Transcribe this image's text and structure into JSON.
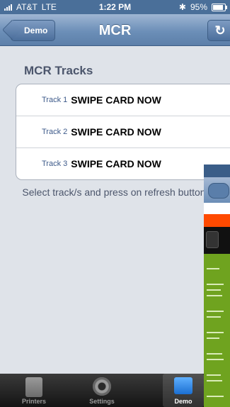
{
  "status": {
    "carrier": "AT&T",
    "network": "LTE",
    "time": "1:22 PM",
    "battery": "95%"
  },
  "nav": {
    "back_label": "Demo",
    "title": "MCR",
    "refresh_icon": "refresh-icon"
  },
  "section_title": "MCR Tracks",
  "tracks": [
    {
      "label": "Track 1",
      "value": "SWIPE CARD NOW"
    },
    {
      "label": "Track 2",
      "value": "SWIPE CARD NOW"
    },
    {
      "label": "Track 3",
      "value": "SWIPE CARD NOW"
    }
  ],
  "hint": "Select track/s and press on refresh button",
  "tabbar": {
    "tabs": [
      {
        "label": "Printers",
        "icon": "printer-icon"
      },
      {
        "label": "Settings",
        "icon": "gear-icon"
      },
      {
        "label": "Demo",
        "icon": "demo-icon",
        "active": true
      }
    ]
  },
  "colors": {
    "nav_bar": "#6c8fb8",
    "background": "#dfe3e9",
    "track_label": "#3d5a8a"
  }
}
